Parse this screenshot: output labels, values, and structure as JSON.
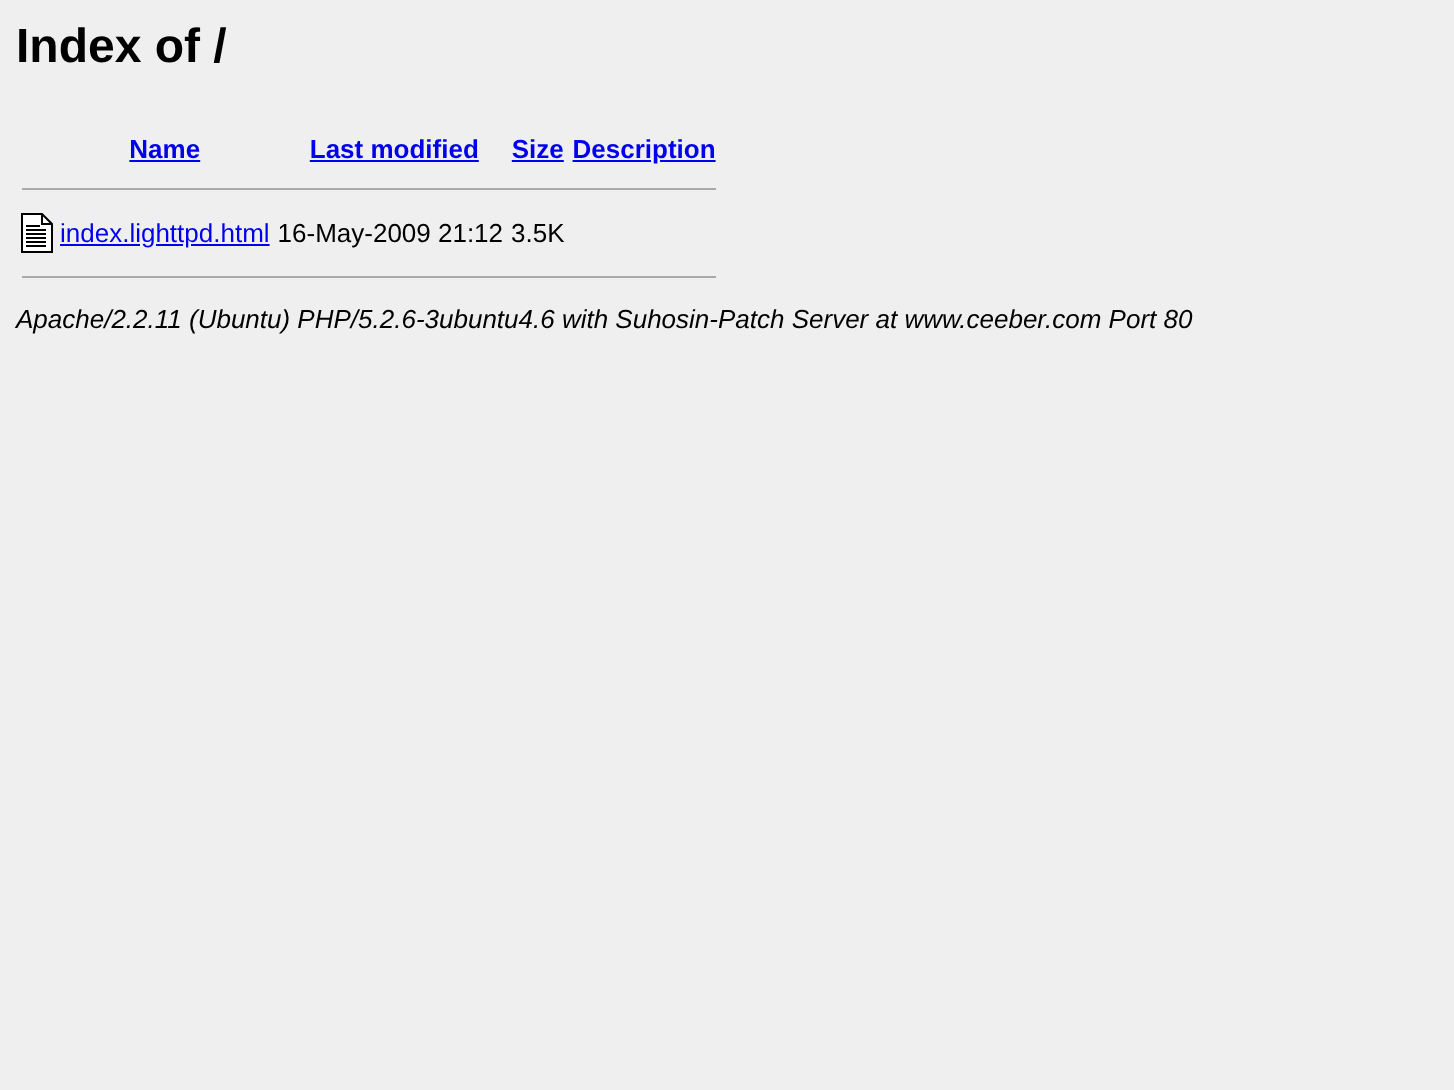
{
  "title": "Index of /",
  "columns": [
    {
      "label": "Name"
    },
    {
      "label": "Last modified"
    },
    {
      "label": "Size"
    },
    {
      "label": "Description"
    }
  ],
  "rows": [
    {
      "name": "index.lighttpd.html",
      "modified": "16-May-2009 21:12",
      "size": "3.5K"
    }
  ],
  "footer": "Apache/2.2.11 (Ubuntu) PHP/5.2.6-3ubuntu4.6 with Suhosin-Patch Server at www.ceeber.com Port 80"
}
